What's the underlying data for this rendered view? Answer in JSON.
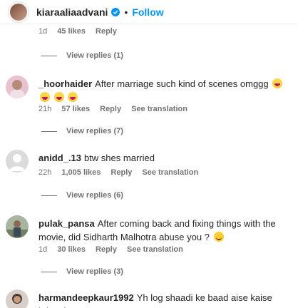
{
  "header": {
    "username": "kiaraaliaadvani",
    "separator": "•",
    "follow_label": "Follow"
  },
  "top_comment_meta": {
    "age": "1d",
    "likes": "45 likes",
    "reply": "Reply"
  },
  "view_replies": [
    "View replies (1)",
    "View replies (7)",
    "View replies (6)",
    "View replies (3)"
  ],
  "comments": [
    {
      "username": "_hoorhaider",
      "text": "After marriage such kind of scenes omggg",
      "age": "21h",
      "likes": "57 likes",
      "reply": "Reply",
      "translation": "See translation"
    },
    {
      "username": "anidd_.13",
      "text": "btw shes married",
      "age": "22h",
      "likes": "1,005 likes",
      "reply": "Reply",
      "translation": "See translation"
    },
    {
      "username": "pulak_pansa",
      "text": "After coming back and fixing things with the movie, did Sidharth Malhotra abuse you ?",
      "age": "1d",
      "likes": "30 likes",
      "reply": "Reply",
      "translation": "See translation"
    },
    {
      "username": "harmandeepkaur1992",
      "text": "Yh log shaadi ke baad aise kaise krlete h ...",
      "age": "",
      "likes": "",
      "reply": "",
      "translation": ""
    }
  ],
  "colors": {
    "link_blue": "#0095f6",
    "secondary_text": "#737373",
    "primary_text": "#262626"
  },
  "icons": [
    "verified-badge-icon",
    "laughing-emoji-icon",
    "smiling-emoji-icon"
  ]
}
